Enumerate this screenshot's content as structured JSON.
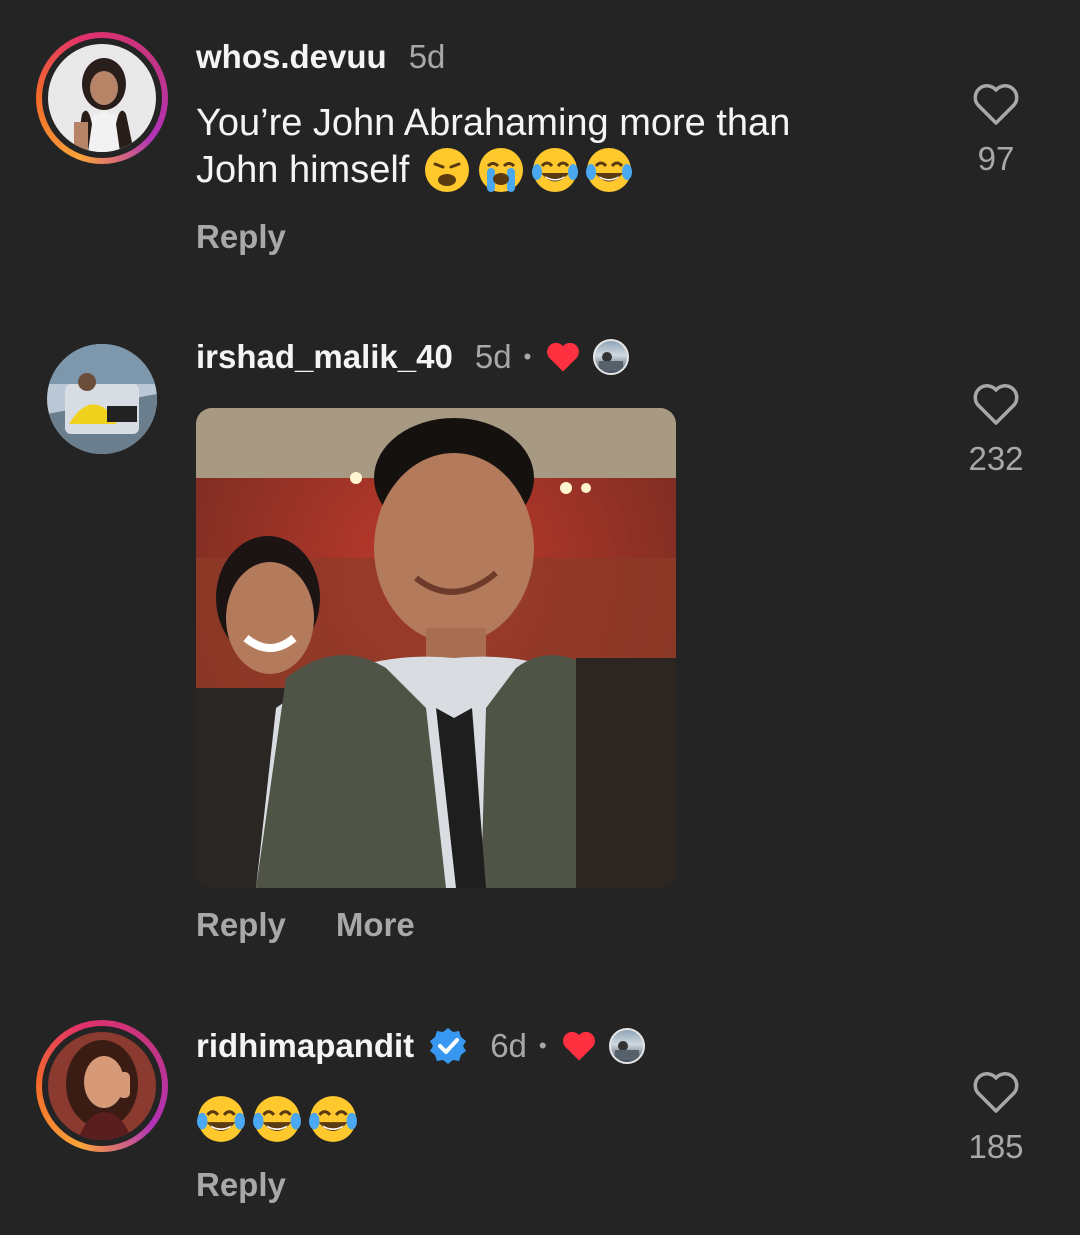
{
  "comments": [
    {
      "username": "whos.devuu",
      "time": "5d",
      "text_line1": "You’re John Abrahaming more than",
      "text_line2": "John himself",
      "emojis": [
        "weary-face",
        "loudly-crying-face",
        "face-with-tears-of-joy",
        "face-with-tears-of-joy"
      ],
      "likes": "97",
      "actions": [
        "Reply"
      ]
    },
    {
      "username": "irshad_malik_40",
      "time": "5d",
      "dot": "•",
      "liked_by_author": true,
      "likes": "232",
      "actions": [
        "Reply",
        "More"
      ],
      "media": "gif-image"
    },
    {
      "username": "ridhimapandit",
      "verified": true,
      "time": "6d",
      "dot": "•",
      "liked_by_author": true,
      "emojis": [
        "face-with-tears-of-joy",
        "face-with-tears-of-joy",
        "face-with-tears-of-joy"
      ],
      "likes": "185",
      "actions": [
        "Reply"
      ]
    }
  ],
  "colors": {
    "background": "#242424",
    "text": "#f4f4f4",
    "muted": "#a8a8a8",
    "heart_red": "#ff3040",
    "verified_blue": "#3897f0"
  }
}
